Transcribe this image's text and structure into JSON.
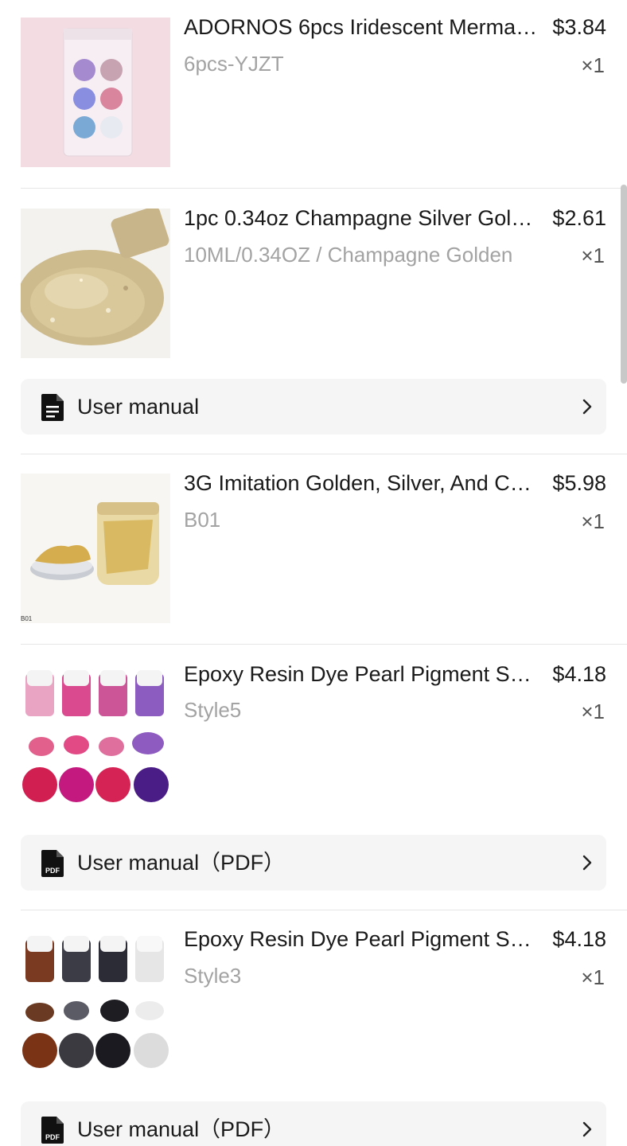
{
  "items": [
    {
      "title": "ADORNOS 6pcs Iridescent Merma…",
      "price": "$3.84",
      "variant": "6pcs-YJZT",
      "quantity": "×1",
      "image": "mermaid-glitter-pack-image"
    },
    {
      "title": "1pc 0.34oz Champagne Silver Gol…",
      "price": "$2.61",
      "variant": "10ML/0.34OZ / Champagne Golden",
      "quantity": "×1",
      "image": "champagne-glitter-image",
      "manual_label": "User manual"
    },
    {
      "title": "3G Imitation Golden, Silver, And C…",
      "price": "$5.98",
      "variant": "B01",
      "quantity": "×1",
      "image": "gold-leaf-jar-image",
      "image_caption": "B01"
    },
    {
      "title": "Epoxy Resin Dye Pearl Pigment S…",
      "price": "$4.18",
      "variant": "Style5",
      "quantity": "×1",
      "image": "pink-pigment-set-image",
      "manual_label": "User manual（PDF）"
    },
    {
      "title": "Epoxy Resin Dye Pearl Pigment S…",
      "price": "$4.18",
      "variant": "Style3",
      "quantity": "×1",
      "image": "dark-pigment-set-image",
      "manual_label": "User manual（PDF）"
    }
  ],
  "icons": {
    "doc": "document-icon",
    "pdf": "pdf-icon",
    "pdf_text": "PDF",
    "chevron": "chevron-right-icon"
  }
}
